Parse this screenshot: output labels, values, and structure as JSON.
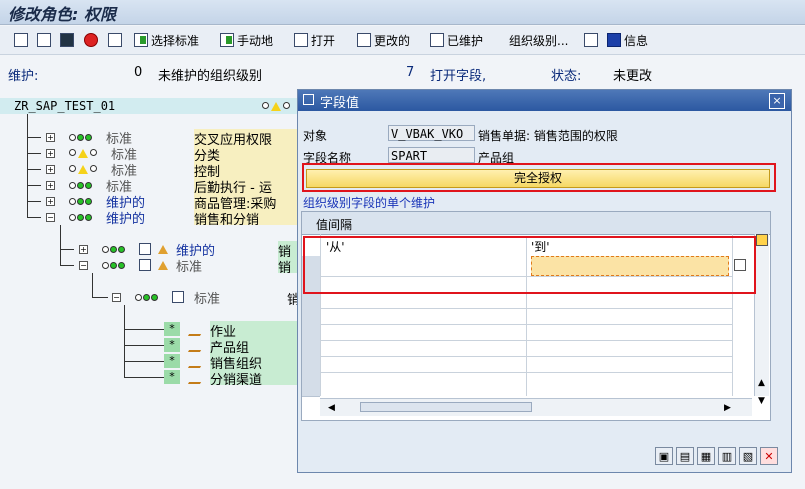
{
  "window": {
    "title": "修改角色: 权限"
  },
  "toolbar": {
    "select_template": "选择标准",
    "manual": "手动地",
    "open": "打开",
    "changed": "更改的",
    "maintained": "已维护",
    "org_levels": "组织级别...",
    "info": "信息"
  },
  "status": {
    "maint_label": "维护:",
    "unmaint_count": "0",
    "unmaint_text": "未维护的组织级别",
    "open_count": "7",
    "open_text": "打开字段,",
    "state_label": "状态:",
    "state_value": "未更改"
  },
  "tree": {
    "root": "ZR_SAP_TEST_01",
    "nodes": [
      {
        "label": "标准",
        "desc": "交叉应用权限"
      },
      {
        "label": "标准",
        "desc": "分类"
      },
      {
        "label": "标准",
        "desc": "控制"
      },
      {
        "label": "标准",
        "desc": "后勤执行 - 运"
      },
      {
        "label": "维护的",
        "desc": "商品管理:采购"
      },
      {
        "label": "维护的",
        "desc": "销售和分销"
      }
    ],
    "sub": [
      {
        "label": "维护的",
        "desc": "销"
      },
      {
        "label": "标准",
        "desc": "销"
      }
    ],
    "subsub": {
      "label": "标准",
      "desc": "销"
    },
    "fields": [
      "作业",
      "产品组",
      "销售组织",
      "分销渠道"
    ],
    "field_marker": "*"
  },
  "dialog": {
    "title": "字段值",
    "object_label": "对象",
    "object_value": "V_VBAK_VKO",
    "object_desc": "销售单据: 销售范围的权限",
    "field_label": "字段名称",
    "field_value": "SPART",
    "field_desc": "产品组",
    "full_auth": "完全授权",
    "section": "组织级别字段的单个维护",
    "grid_title": "值间隔",
    "col_from": "'从'",
    "col_to": "'到'",
    "close_symbol": "×"
  },
  "colors": {
    "accent": "#2c58a1",
    "highlight_red": "#e0141c",
    "full_auth_bg": "#f6d864"
  }
}
